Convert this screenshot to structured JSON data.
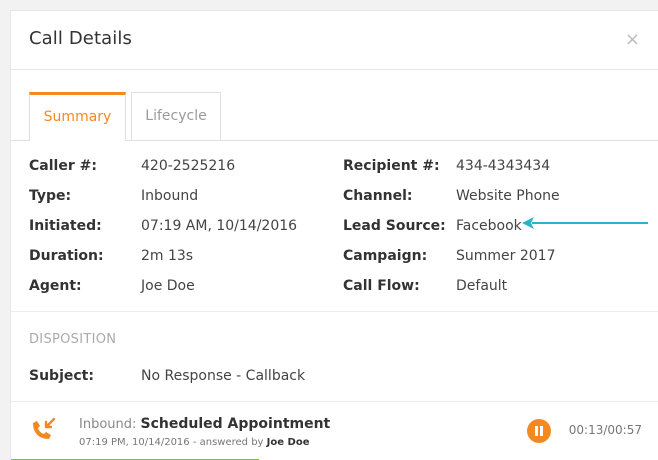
{
  "dialog": {
    "title": "Call Details",
    "close": "×"
  },
  "tabs": [
    {
      "label": "Summary",
      "active": true
    },
    {
      "label": "Lifecycle",
      "active": false
    }
  ],
  "details": [
    {
      "left_label": "Caller #:",
      "left_value": "420-2525216",
      "right_label": "Recipient #:",
      "right_value": "434-4343434"
    },
    {
      "left_label": "Type:",
      "left_value": "Inbound",
      "right_label": "Channel:",
      "right_value": "Website Phone"
    },
    {
      "left_label": "Initiated:",
      "left_value": "07:19 AM, 10/14/2016",
      "right_label": "Lead Source:",
      "right_value": "Facebook"
    },
    {
      "left_label": "Duration:",
      "left_value": "2m 13s",
      "right_label": "Campaign:",
      "right_value": "Summer 2017"
    },
    {
      "left_label": "Agent:",
      "left_value": "Joe Doe",
      "right_label": "Call Flow:",
      "right_value": "Default"
    }
  ],
  "disposition": {
    "section_title": "DISPOSITION",
    "subject_label": "Subject:",
    "subject_value": "No Response - Callback"
  },
  "call": {
    "direction": "Inbound:",
    "event": "Scheduled Appointment",
    "time": "07:19 PM, 10/14/2016",
    "answered_prefix": "- answered by",
    "answered_by": "Joe Doe",
    "playback": "00:13/00:57",
    "progress": 0.23
  },
  "colors": {
    "accent": "#f4891f",
    "progress": "#7cc242",
    "annotation_arrow": "#2bb3c7"
  },
  "icons": {
    "call": "incoming-call-icon",
    "pause": "pause-icon",
    "close": "close-icon"
  }
}
